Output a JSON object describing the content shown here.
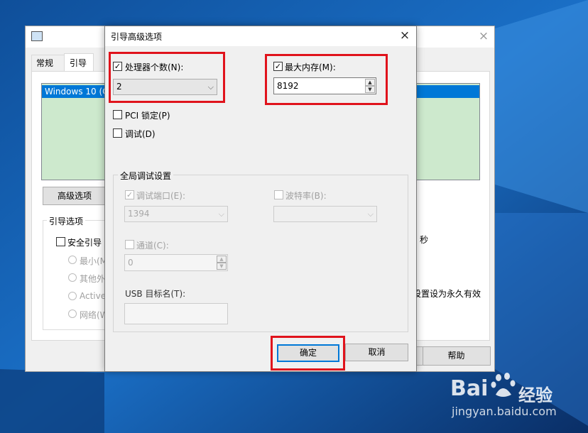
{
  "background_window": {
    "tabs": [
      "常规",
      "引导"
    ],
    "os_list_item": "Windows 10 (C",
    "advanced_button": "高级选项",
    "boot_options_group": "引导选项",
    "safe_boot": "安全引导",
    "radio_items": [
      "最小(M",
      "其他外",
      "Active",
      "网络(W"
    ],
    "seconds_label": "秒",
    "permanent_text": "设置设为永久有效",
    "help_button": "帮助"
  },
  "dialog": {
    "title": "引导高级选项",
    "num_processors_label": "处理器个数(N):",
    "num_processors_value": "2",
    "max_memory_label": "最大内存(M):",
    "max_memory_value": "8192",
    "pci_lock_label": "PCI 锁定(P)",
    "debug_label": "调试(D)",
    "global_debug_group": "全局调试设置",
    "debug_port_label": "调试端口(E):",
    "debug_port_value": "1394",
    "baud_rate_label": "波特率(B):",
    "channel_label": "通道(C):",
    "channel_value": "0",
    "usb_target_label": "USB 目标名(T):",
    "ok_button": "确定",
    "cancel_button": "取消"
  },
  "watermark": {
    "brand": "Bai",
    "brand2": "经验",
    "url": "jingyan.baidu.com"
  },
  "colors": {
    "highlight_red": "#e0131c",
    "selection_blue": "#0078d7",
    "list_green": "#cde9cd"
  },
  "icons": {
    "close": "×",
    "check": "✓",
    "dropdown": "⌵",
    "spin_up": "▲",
    "spin_down": "▼"
  }
}
